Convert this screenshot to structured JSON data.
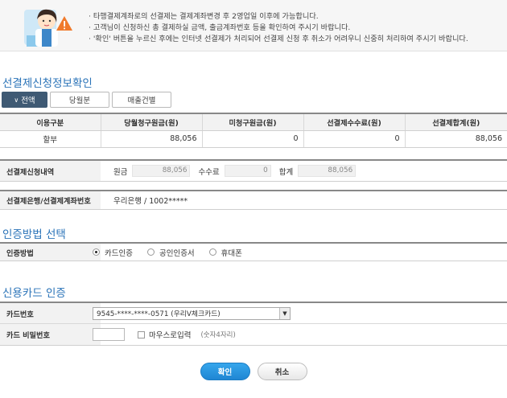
{
  "notice": {
    "lines": [
      "· 타행결제계좌로의 선결제는 결제계좌변경 후 2영업일 이후에 가능합니다.",
      "· 고객님이 신청하신 총 결제하실 금액, 출금계좌번호 등을 확인하여 주시기 바랍니다.",
      "· '확인' 버튼을 누르신 후에는 인터넷 선결제가 처리되어 선결제 신청 후 취소가 어려우니 신중히 처리하여 주시기 바랍니다."
    ]
  },
  "section1": {
    "title": "선결제신청정보확인",
    "tabs": [
      {
        "label": "전액",
        "active": true
      },
      {
        "label": "당월분",
        "active": false
      },
      {
        "label": "매출건별",
        "active": false
      }
    ],
    "table": {
      "headers": [
        "이용구분",
        "당월청구원금(원)",
        "미청구원금(원)",
        "선결제수수료(원)",
        "선결제합계(원)"
      ],
      "rows": [
        [
          "할부",
          "88,056",
          "0",
          "0",
          "88,056"
        ]
      ]
    },
    "apply_detail": {
      "label": "선결제신청내역",
      "principal_label": "원금",
      "principal_value": "88,056",
      "fee_label": "수수료",
      "fee_value": "0",
      "total_label": "합계",
      "total_value": "88,056"
    },
    "bank": {
      "label": "선결제은행/선결제계좌번호",
      "value": "우리은행 / 1002*****"
    }
  },
  "section2": {
    "title": "인증방법 선택",
    "label": "인증방법",
    "options": [
      {
        "label": "카드인증",
        "selected": true
      },
      {
        "label": "공인인증서",
        "selected": false
      },
      {
        "label": "휴대폰",
        "selected": false
      }
    ]
  },
  "section3": {
    "title": "신용카드 인증",
    "card_label": "카드번호",
    "card_value": "9545-****-****-0571 (우리V체크카드)",
    "pw_label": "카드 비밀번호",
    "mouse_label": "마우스로입력",
    "hint": "(숫자4자리)"
  },
  "buttons": {
    "confirm": "확인",
    "cancel": "취소"
  },
  "colors": {
    "accent": "#2a73b8",
    "active_tab": "#3f5a74",
    "primary_button": "#1f86d3"
  }
}
